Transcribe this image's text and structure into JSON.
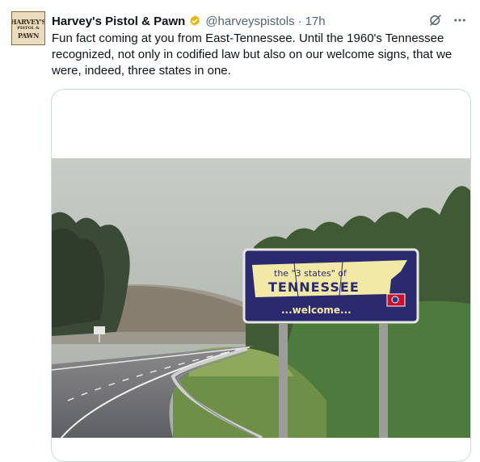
{
  "tweet": {
    "display_name": "Harvey's Pistol & Pawn",
    "handle": "@harveyspistols",
    "separator": "·",
    "time": "17h",
    "text": "Fun fact coming at you from East-Tennessee. Until the 1960's Tennessee recognized, not only in codified law but also on our welcome signs, that we were, indeed, three states in one."
  },
  "avatar": {
    "line1": "HARVEY'S",
    "line2": "PISTOL &",
    "line3": "PAWN"
  },
  "photo": {
    "sign_top": "the \"3 states\" of",
    "sign_name": "TENNESSEE",
    "sign_bottom": "...welcome..."
  },
  "icons": {
    "verified": "verified-badge-icon",
    "grok": "grok-icon",
    "more": "more-icon"
  },
  "colors": {
    "verified_gold": "#e2b719",
    "sign_blue": "#2b2a6e",
    "sign_yellow": "#f3e9a6"
  }
}
